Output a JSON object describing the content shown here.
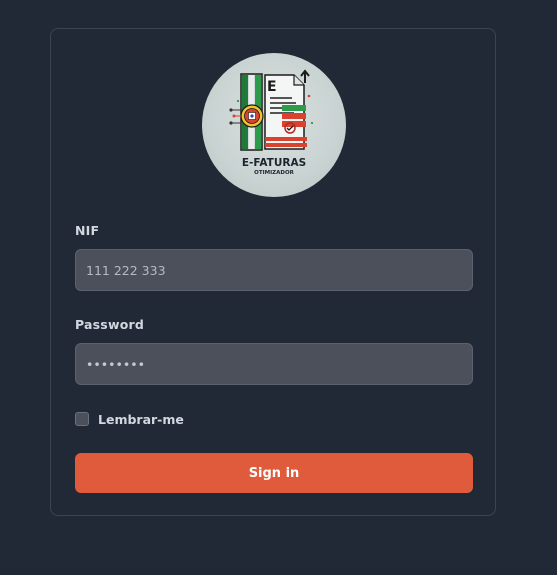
{
  "logo": {
    "brand_line1": "E-FATURAS",
    "brand_line2": "OTIMIZADOR",
    "doc_letter": "E"
  },
  "form": {
    "nif_label": "NIF",
    "nif_placeholder": "111 222 333",
    "password_label": "Password",
    "password_value": "••••••••",
    "remember_label": "Lembrar-me",
    "remember_checked": false,
    "signin_label": "Sign in"
  },
  "colors": {
    "background": "#222936",
    "accent": "#df5b3c",
    "input_bg": "#4b505b",
    "card_border": "#3c4454"
  }
}
